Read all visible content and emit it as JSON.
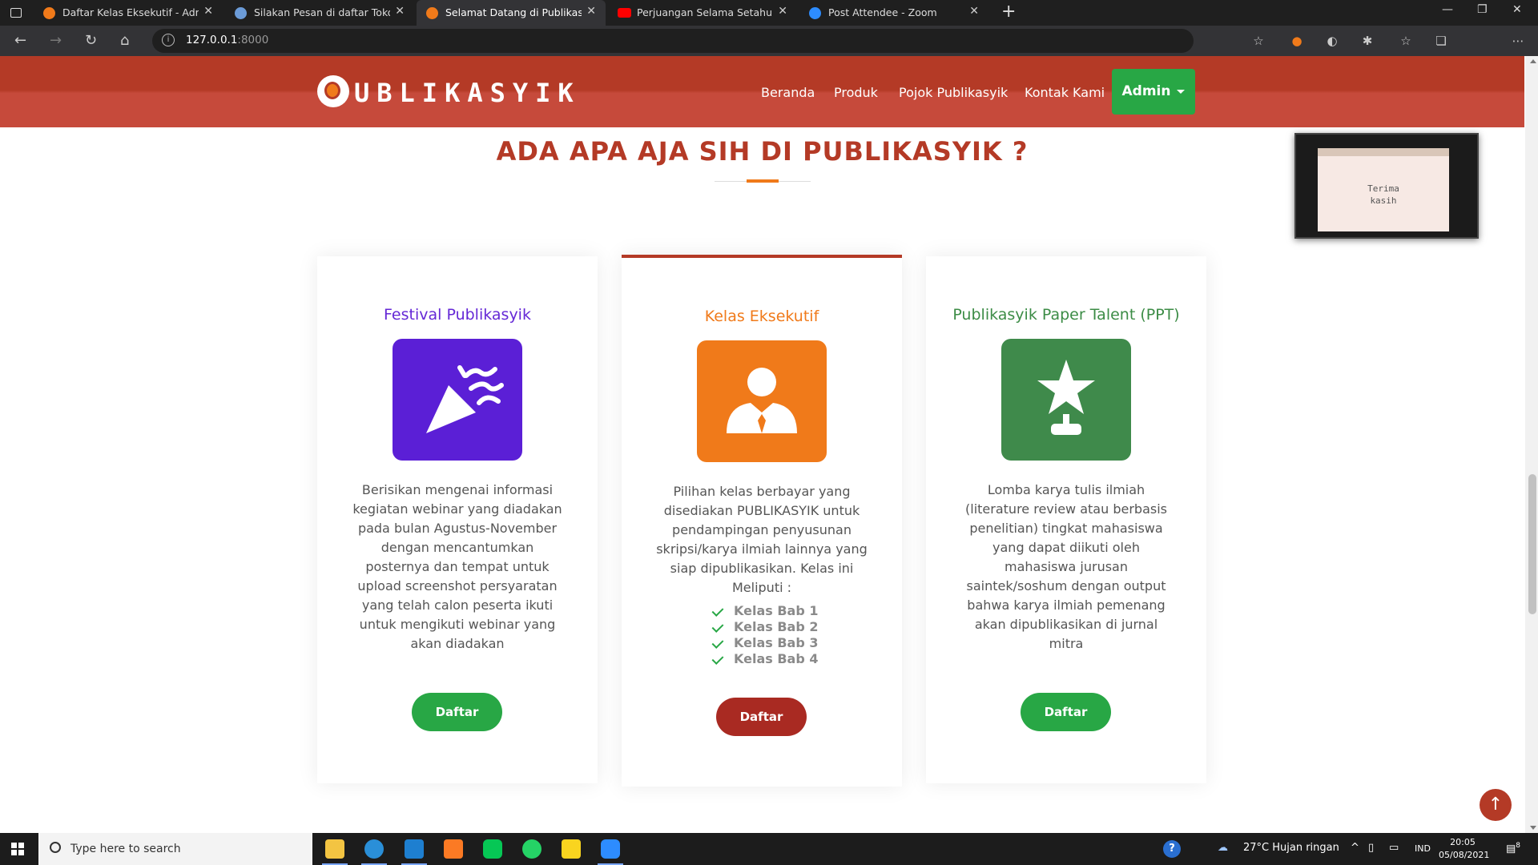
{
  "browser": {
    "tabs": [
      {
        "title": "Daftar Kelas Eksekutif - Admin",
        "favicon": "publikasyik-icon",
        "color": "#f07a1a"
      },
      {
        "title": "Silakan Pesan di daftar Toko ini !",
        "favicon": "globe-icon",
        "color": "#6b9bd8"
      },
      {
        "title": "Selamat Datang di Publikasyik",
        "favicon": "publikasyik-icon",
        "color": "#f07a1a",
        "active": true
      },
      {
        "title": "Perjuangan Selama Setahun - Yo",
        "favicon": "youtube-icon",
        "color": "#ff0000"
      },
      {
        "title": "Post Attendee - Zoom",
        "favicon": "zoom-icon",
        "color": "#2d8cff"
      }
    ],
    "url_host": "127.0.0.1",
    "url_port": ":8000"
  },
  "site": {
    "logo": "UBLIKASYIK",
    "nav": [
      "Beranda",
      "Produk",
      "Pojok Publikasyik",
      "Kontak Kami"
    ],
    "admin_label": "Admin",
    "section_title": "ADA APA AJA SIH DI PUBLIKASYIK ?"
  },
  "cards": [
    {
      "title": "Festival Publikasyik",
      "title_color": "#6528d6",
      "icon": "party-popper-icon",
      "icon_bg": "#5b1fd6",
      "description": "Berisikan mengenai informasi kegiatan webinar yang diadakan pada bulan Agustus-November dengan mencantumkan posternya dan tempat untuk upload screenshot persyaratan yang telah calon peserta ikuti untuk mengikuti webinar yang akan diadakan",
      "button": "Daftar",
      "button_color": "#28a745"
    },
    {
      "title": "Kelas Eksekutif",
      "title_color": "#f07a1a",
      "icon": "executive-user-icon",
      "icon_bg": "#f07a1a",
      "description": "Pilihan kelas berbayar yang disediakan PUBLIKASYIK untuk pendampingan penyusunan skripsi/karya ilmiah lainnya yang siap dipublikasikan. Kelas ini Meliputi :",
      "items": [
        "Kelas Bab 1",
        "Kelas Bab 2",
        "Kelas Bab 3",
        "Kelas Bab 4"
      ],
      "button": "Daftar",
      "button_color": "#a92a22"
    },
    {
      "title": "Publikasyik Paper Talent (PPT)",
      "title_color": "#3c8c46",
      "icon": "star-award-icon",
      "icon_bg": "#3f8a4b",
      "description": "Lomba karya tulis ilmiah (literature review atau berbasis penelitian) tingkat mahasiswa yang dapat diikuti oleh mahasiswa jurusan saintek/soshum dengan output bahwa karya ilmiah pemenang akan dipublikasikan di jurnal mitra",
      "button": "Daftar",
      "button_color": "#28a745"
    }
  ],
  "pip": {
    "text_line1": "Terima",
    "text_line2": "kasih"
  },
  "taskbar": {
    "search_placeholder": "Type here to search",
    "weather": "27°C  Hujan ringan",
    "lang": "IND",
    "time": "20:05",
    "date": "05/08/2021",
    "notif_count": "8"
  }
}
